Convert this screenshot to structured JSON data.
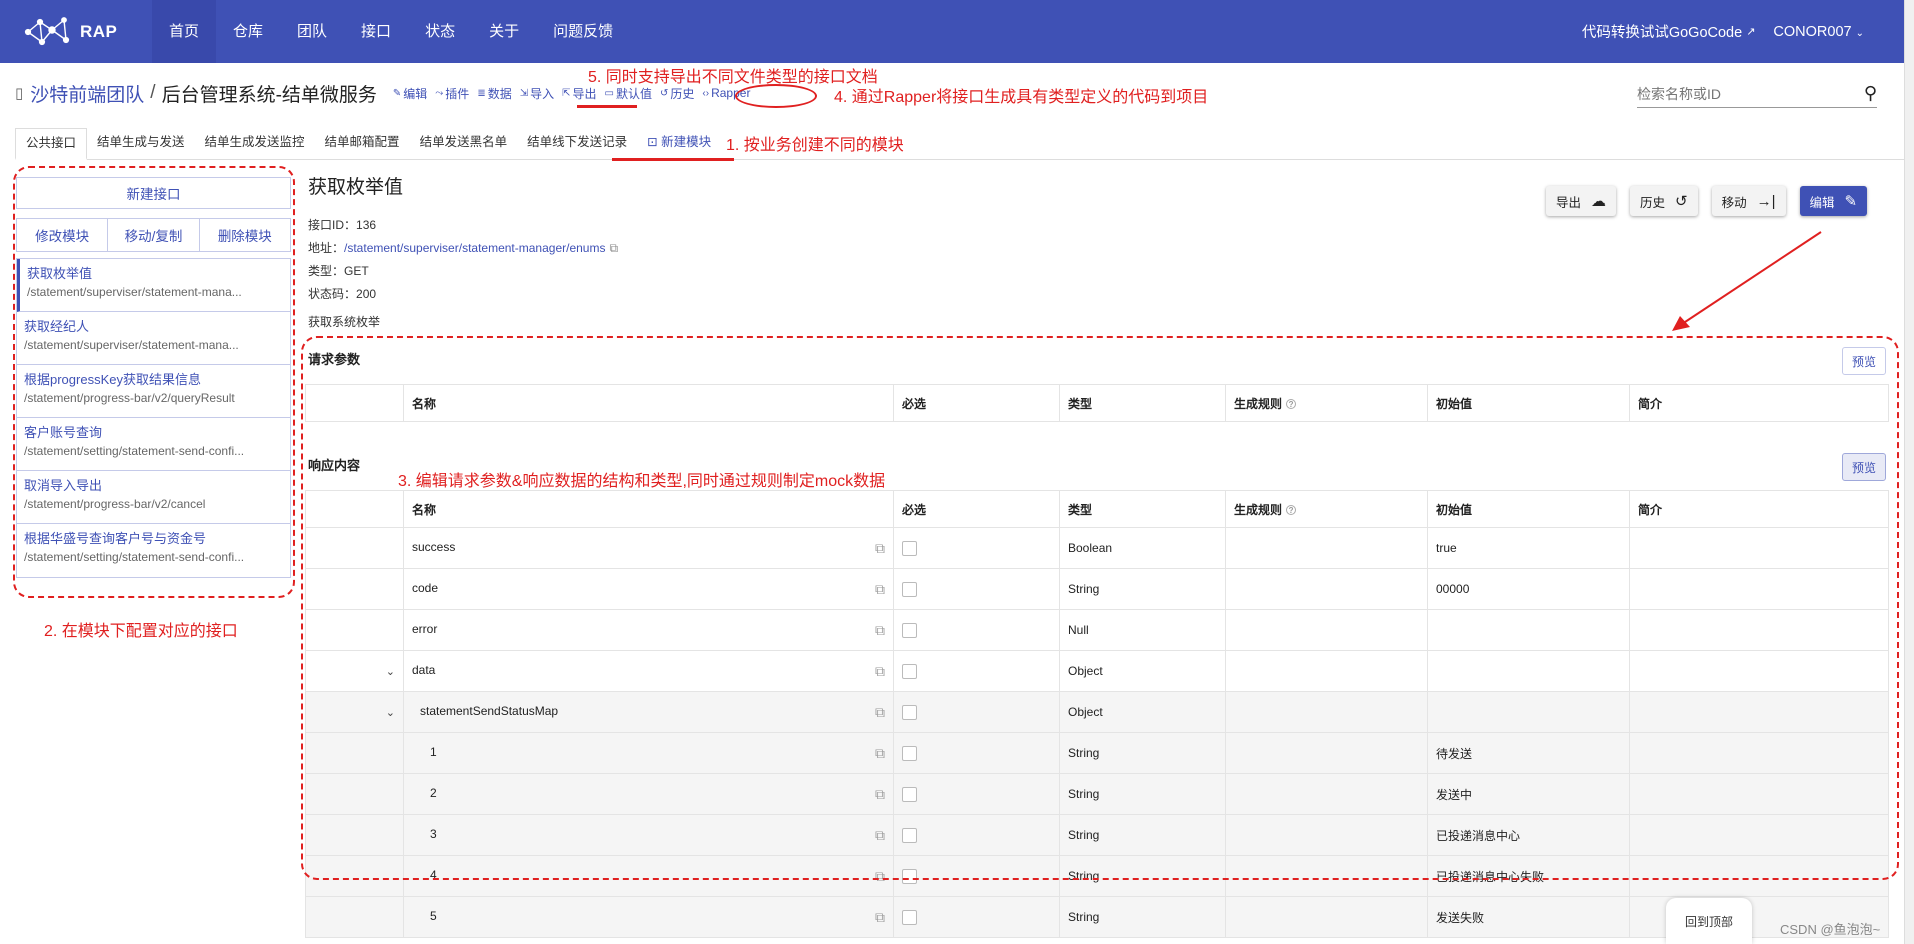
{
  "brand": {
    "logo_text": "RAP"
  },
  "nav": {
    "items": [
      "首页",
      "仓库",
      "团队",
      "接口",
      "状态",
      "关于",
      "问题反馈"
    ],
    "active": "首页"
  },
  "topright": {
    "gogocode": "代码转换试试GoGoCode",
    "user": "CONOR007"
  },
  "header": {
    "team": "沙特前端团队",
    "slash": "/",
    "repo": "后台管理系统-结单微服务",
    "actions": [
      {
        "icon": "✎",
        "label": "编辑"
      },
      {
        "icon": "⤳",
        "label": "插件"
      },
      {
        "icon": "≣",
        "label": "数据"
      },
      {
        "icon": "⇲",
        "label": "导入"
      },
      {
        "icon": "⇱",
        "label": "导出"
      },
      {
        "icon": "▭",
        "label": "默认值"
      },
      {
        "icon": "↺",
        "label": "历史"
      },
      {
        "icon": "‹›",
        "label": "Rapper"
      }
    ]
  },
  "search": {
    "placeholder": "检索名称或ID"
  },
  "tabs": [
    "公共接口",
    "结单生成与发送",
    "结单生成发送监控",
    "结单邮箱配置",
    "结单发送黑名单",
    "结单线下发送记录",
    "新建模块"
  ],
  "sidebar": {
    "new_interface": "新建接口",
    "modify_module": "修改模块",
    "move_copy": "移动/复制",
    "delete_module": "删除模块",
    "items": [
      {
        "name": "获取枚举值",
        "url": "/statement/superviser/statement-mana..."
      },
      {
        "name": "获取经纪人",
        "url": "/statement/superviser/statement-mana..."
      },
      {
        "name": "根据progressKey获取结果信息",
        "url": "/statement/progress-bar/v2/queryResult"
      },
      {
        "name": "客户账号查询",
        "url": "/statement/setting/statement-send-confi..."
      },
      {
        "name": "取消导入导出",
        "url": "/statement/progress-bar/v2/cancel"
      },
      {
        "name": "根据华盛号查询客户号与资金号",
        "url": "/statement/setting/statement-send-confi..."
      }
    ]
  },
  "interface": {
    "title": "获取枚举值",
    "id_label": "接口ID：",
    "id": "136",
    "url_label": "地址：",
    "url": "/statement/superviser/statement-manager/enums",
    "type_label": "类型：",
    "type": "GET",
    "status_label": "状态码：",
    "status": "200",
    "description": "获取系统枚举"
  },
  "buttons": {
    "export": "导出",
    "history": "历史",
    "move": "移动",
    "edit": "编辑",
    "preview": "预览",
    "back_top": "回到顶部"
  },
  "request": {
    "title": "请求参数"
  },
  "response": {
    "title": "响应内容"
  },
  "columns": [
    "名称",
    "必选",
    "类型",
    "生成规则",
    "初始值",
    "简介"
  ],
  "response_rows": [
    {
      "name": "success",
      "type": "Boolean",
      "initial": "true"
    },
    {
      "name": "code",
      "type": "String",
      "initial": "00000"
    },
    {
      "name": "error",
      "type": "Null",
      "initial": ""
    },
    {
      "name": "data",
      "type": "Object",
      "initial": ""
    },
    {
      "name": "statementSendStatusMap",
      "type": "Object",
      "initial": ""
    },
    {
      "name": "1",
      "type": "String",
      "initial": "待发送"
    },
    {
      "name": "2",
      "type": "String",
      "initial": "发送中"
    },
    {
      "name": "3",
      "type": "String",
      "initial": "已投递消息中心"
    },
    {
      "name": "4",
      "type": "String",
      "initial": "已投递消息中心失败"
    },
    {
      "name": "5",
      "type": "String",
      "initial": "发送失败"
    }
  ],
  "annotations": {
    "a1": "1. 按业务创建不同的模块",
    "a2": "2. 在模块下配置对应的接口",
    "a3": "3.  编辑请求参数&响应数据的结构和类型,同时通过规则制定mock数据",
    "a4": "4.  通过Rapper将接口生成具有类型定义的代码到项目",
    "a5": "5. 同时支持导出不同文件类型的接口文档"
  },
  "watermark": "CSDN @鱼泡泡~",
  "colors": {
    "primary": "#3f51b5",
    "annotation": "#e02020"
  }
}
